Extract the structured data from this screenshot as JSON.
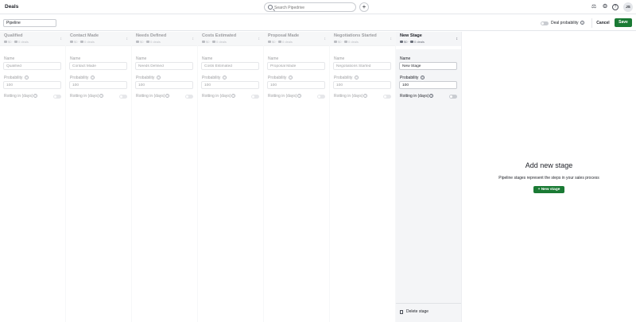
{
  "header": {
    "title": "Deals",
    "search_placeholder": "Search Pipedrive",
    "add_label": "+",
    "avatar_initials": "JS",
    "icons": [
      "sales-assistant-icon",
      "lightbulb-icon",
      "help-icon"
    ]
  },
  "subheader": {
    "pipeline_name": "Pipeline",
    "deal_probability_label": "Deal probability",
    "cancel_label": "Cancel",
    "save_label": "Save"
  },
  "form_labels": {
    "name": "Name",
    "probability": "Probability",
    "rotting": "Rotting in (days)"
  },
  "stages": [
    {
      "title": "Qualified",
      "value": "$0",
      "deals": "0 deals",
      "name": "Qualified",
      "probability": "100"
    },
    {
      "title": "Contact Made",
      "value": "$0",
      "deals": "0 deals",
      "name": "Contact Made",
      "probability": "100"
    },
    {
      "title": "Needs Defined",
      "value": "$0",
      "deals": "0 deals",
      "name": "Needs Defined",
      "probability": "100"
    },
    {
      "title": "Costs Estimated",
      "value": "$0",
      "deals": "0 deals",
      "name": "Costs Estimated",
      "probability": "100"
    },
    {
      "title": "Proposal Made",
      "value": "$0",
      "deals": "0 deals",
      "name": "Proposal Made",
      "probability": "100"
    },
    {
      "title": "Negotiations Started",
      "value": "$0",
      "deals": "0 deals",
      "name": "Negotiations Started",
      "probability": "100"
    },
    {
      "title": "New Stage",
      "value": "$0",
      "deals": "0 deals",
      "name": "New Stage",
      "probability": "100"
    }
  ],
  "active_stage": {
    "delete_label": "Delete stage"
  },
  "empty_state": {
    "title": "Add new stage",
    "description": "Pipeline stages represent the steps in your sales process",
    "button_label": "+  New stage"
  },
  "colors": {
    "primary_green": "#1a7a34",
    "border": "#c9ccd1",
    "panel_bg": "#f4f5f7"
  }
}
